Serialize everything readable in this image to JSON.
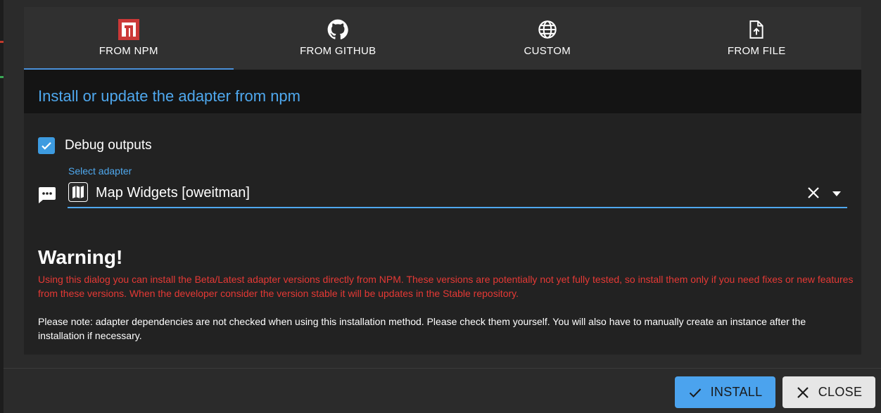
{
  "tabs": [
    {
      "label": "FROM NPM",
      "icon": "npm-icon",
      "active": true
    },
    {
      "label": "FROM GITHUB",
      "icon": "github-icon",
      "active": false
    },
    {
      "label": "CUSTOM",
      "icon": "globe-icon",
      "active": false
    },
    {
      "label": "FROM FILE",
      "icon": "file-upload-icon",
      "active": false
    }
  ],
  "header": {
    "title": "Install or update the adapter from npm"
  },
  "debug": {
    "label": "Debug outputs",
    "checked": true
  },
  "select": {
    "label": "Select adapter",
    "value": "Map Widgets [oweitman]"
  },
  "warning": {
    "title": "Warning!",
    "text": "Using this dialog you can install the Beta/Latest adapter versions directly from NPM. These versions are potentially not yet fully tested, so install them only if you need fixes or new features from these versions. When the developer consider the version stable it will be updates in the Stable repository.",
    "note": "Please note: adapter dependencies are not checked when using this installation method. Please check them yourself. You will also have to manually create an instance after the installation if necessary."
  },
  "buttons": {
    "install": "INSTALL",
    "close": "CLOSE"
  },
  "colors": {
    "accent": "#4fa8ee",
    "warning": "#e53935",
    "npm_red": "#cb3837"
  }
}
